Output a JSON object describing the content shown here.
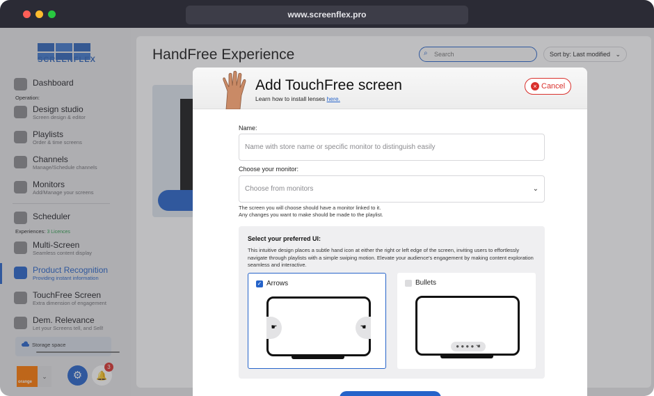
{
  "browser": {
    "url": "www.screenflex.pro"
  },
  "sidebar": {
    "logo_text": "SCREENFLEX",
    "dashboard": "Dashboard",
    "operation_section": "Operation:",
    "items_operation": [
      {
        "label": "Design studio",
        "sub": "Screen design & editor"
      },
      {
        "label": "Playlists",
        "sub": "Order & time screens"
      },
      {
        "label": "Channels",
        "sub": "Manage/Schedule channels"
      },
      {
        "label": "Monitors",
        "sub": "Add/Manage your screens"
      }
    ],
    "scheduler": "Scheduler",
    "experiences_section": "Experiences:",
    "licences": "3 Licences",
    "items_experiences": [
      {
        "label": "Multi-Screen",
        "sub": "Seamless content display"
      },
      {
        "label": "Product Recognition",
        "sub": "Providing instant information"
      },
      {
        "label": "TouchFree Screen",
        "sub": "Extra dimension of engagement"
      },
      {
        "label": "Dem. Relevance",
        "sub": "Let your Screens tell, and Sell!"
      }
    ],
    "storage_label": "Storage space",
    "storage_used": 0.55,
    "account_brand": "orange",
    "notifications_count": "3"
  },
  "main": {
    "title": "HandFree Experience",
    "search_placeholder": "Search",
    "sort_label": "Sort by: Last modified"
  },
  "modal": {
    "title": "Add TouchFree screen",
    "subtitle_prefix": "Learn how to install lenses ",
    "subtitle_link": "here.",
    "cancel_label": "Cancel",
    "name_label": "Name:",
    "name_placeholder": "Name with store name or specific monitor to distinguish easily",
    "monitor_label": "Choose your monitor:",
    "monitor_placeholder": "Choose from monitors",
    "hint_line1": "The screen you will choose should have a monitor linked to it.",
    "hint_line2": "Any changes you want to make should be made to the playlist.",
    "ui_title": "Select your preferred UI:",
    "ui_desc": "This intuitive design places a subtle hand icon at either the right or left edge of the screen, inviting users to effortlessly navigate through playlists with a simple swiping motion. Elevate your audience's engagement by making content exploration seamless and interactive.",
    "options": [
      {
        "label": "Arrows",
        "selected": true
      },
      {
        "label": "Bullets",
        "selected": false
      }
    ]
  },
  "colors": {
    "accent": "#2563c9",
    "danger": "#d9302c",
    "brand_orange": "#ff7900"
  }
}
